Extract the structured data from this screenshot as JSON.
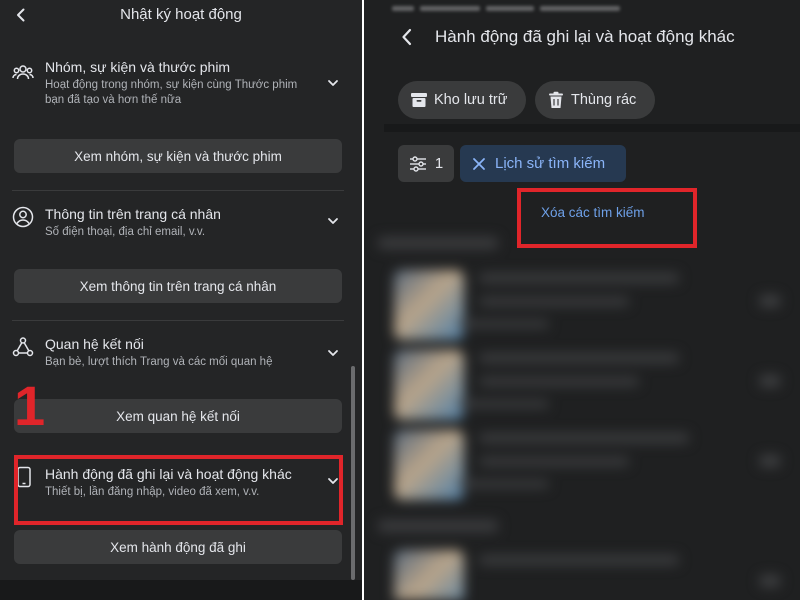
{
  "left_panel": {
    "title": "Nhật ký hoạt động",
    "sections": [
      {
        "title": "Nhóm, sự kiện và thước phim",
        "subtitle": "Hoạt động trong nhóm, sự kiện cùng Thước phim bạn đã tạo và hơn thế nữa",
        "button": "Xem nhóm, sự kiện và thước phim",
        "icon": "group-icon"
      },
      {
        "title": "Thông tin trên trang cá nhân",
        "subtitle": "Số điện thoại, địa chỉ email, v.v.",
        "button": "Xem thông tin trên trang cá nhân",
        "icon": "person-icon"
      },
      {
        "title": "Quan hệ kết nối",
        "subtitle": "Bạn bè, lượt thích Trang và các mối quan hệ",
        "button": "Xem quan hệ kết nối",
        "icon": "connections-icon"
      },
      {
        "title": "Hành động đã ghi lại và hoạt động khác",
        "subtitle": "Thiết bị, lần đăng nhập, video đã xem, v.v.",
        "button": "Xem hành động đã ghi",
        "icon": "phone-icon"
      }
    ],
    "step_number": "1"
  },
  "right_panel": {
    "title": "Hành động đã ghi lại và hoạt động khác",
    "archive_label": "Kho lưu trữ",
    "trash_label": "Thùng rác",
    "filter_count": "1",
    "search_history_chip": "Lịch sử tìm kiếm",
    "clear_searches_link": "Xóa các tìm kiếm"
  },
  "colors": {
    "background": "#242526",
    "button": "#3a3b3c",
    "highlight_red": "#e0252a",
    "link_blue": "#6ea0e8",
    "chip_bg": "#263951"
  }
}
